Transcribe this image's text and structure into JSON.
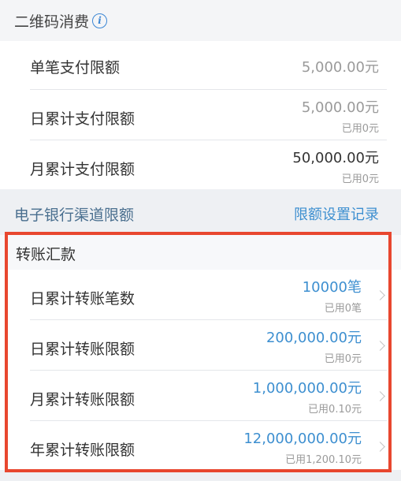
{
  "qr_section": {
    "title": "二维码消费",
    "info_icon": "info-icon",
    "rows": [
      {
        "label": "单笔支付限额",
        "value": "5,000.00元",
        "used": ""
      },
      {
        "label": "日累计支付限额",
        "value": "5,000.00元",
        "used": "已用0元"
      },
      {
        "label": "月累计支付限额",
        "value": "50,000.00元",
        "used": "已用0元"
      }
    ]
  },
  "channel": {
    "title": "电子银行渠道限额",
    "link": "限额设置记录"
  },
  "transfer_section": {
    "title": "转账汇款",
    "rows": [
      {
        "label": "日累计转账笔数",
        "value": "10000笔",
        "used": "已用0笔"
      },
      {
        "label": "日累计转账限额",
        "value": "200,000.00元",
        "used": "已用0元"
      },
      {
        "label": "月累计转账限额",
        "value": "1,000,000.00元",
        "used": "已用0.10元"
      },
      {
        "label": "年累计转账限额",
        "value": "12,000,000.00元",
        "used": "已用1,200.10元"
      }
    ]
  },
  "colors": {
    "accent_blue": "#3d8fd0",
    "highlight_red": "#e8472f"
  }
}
